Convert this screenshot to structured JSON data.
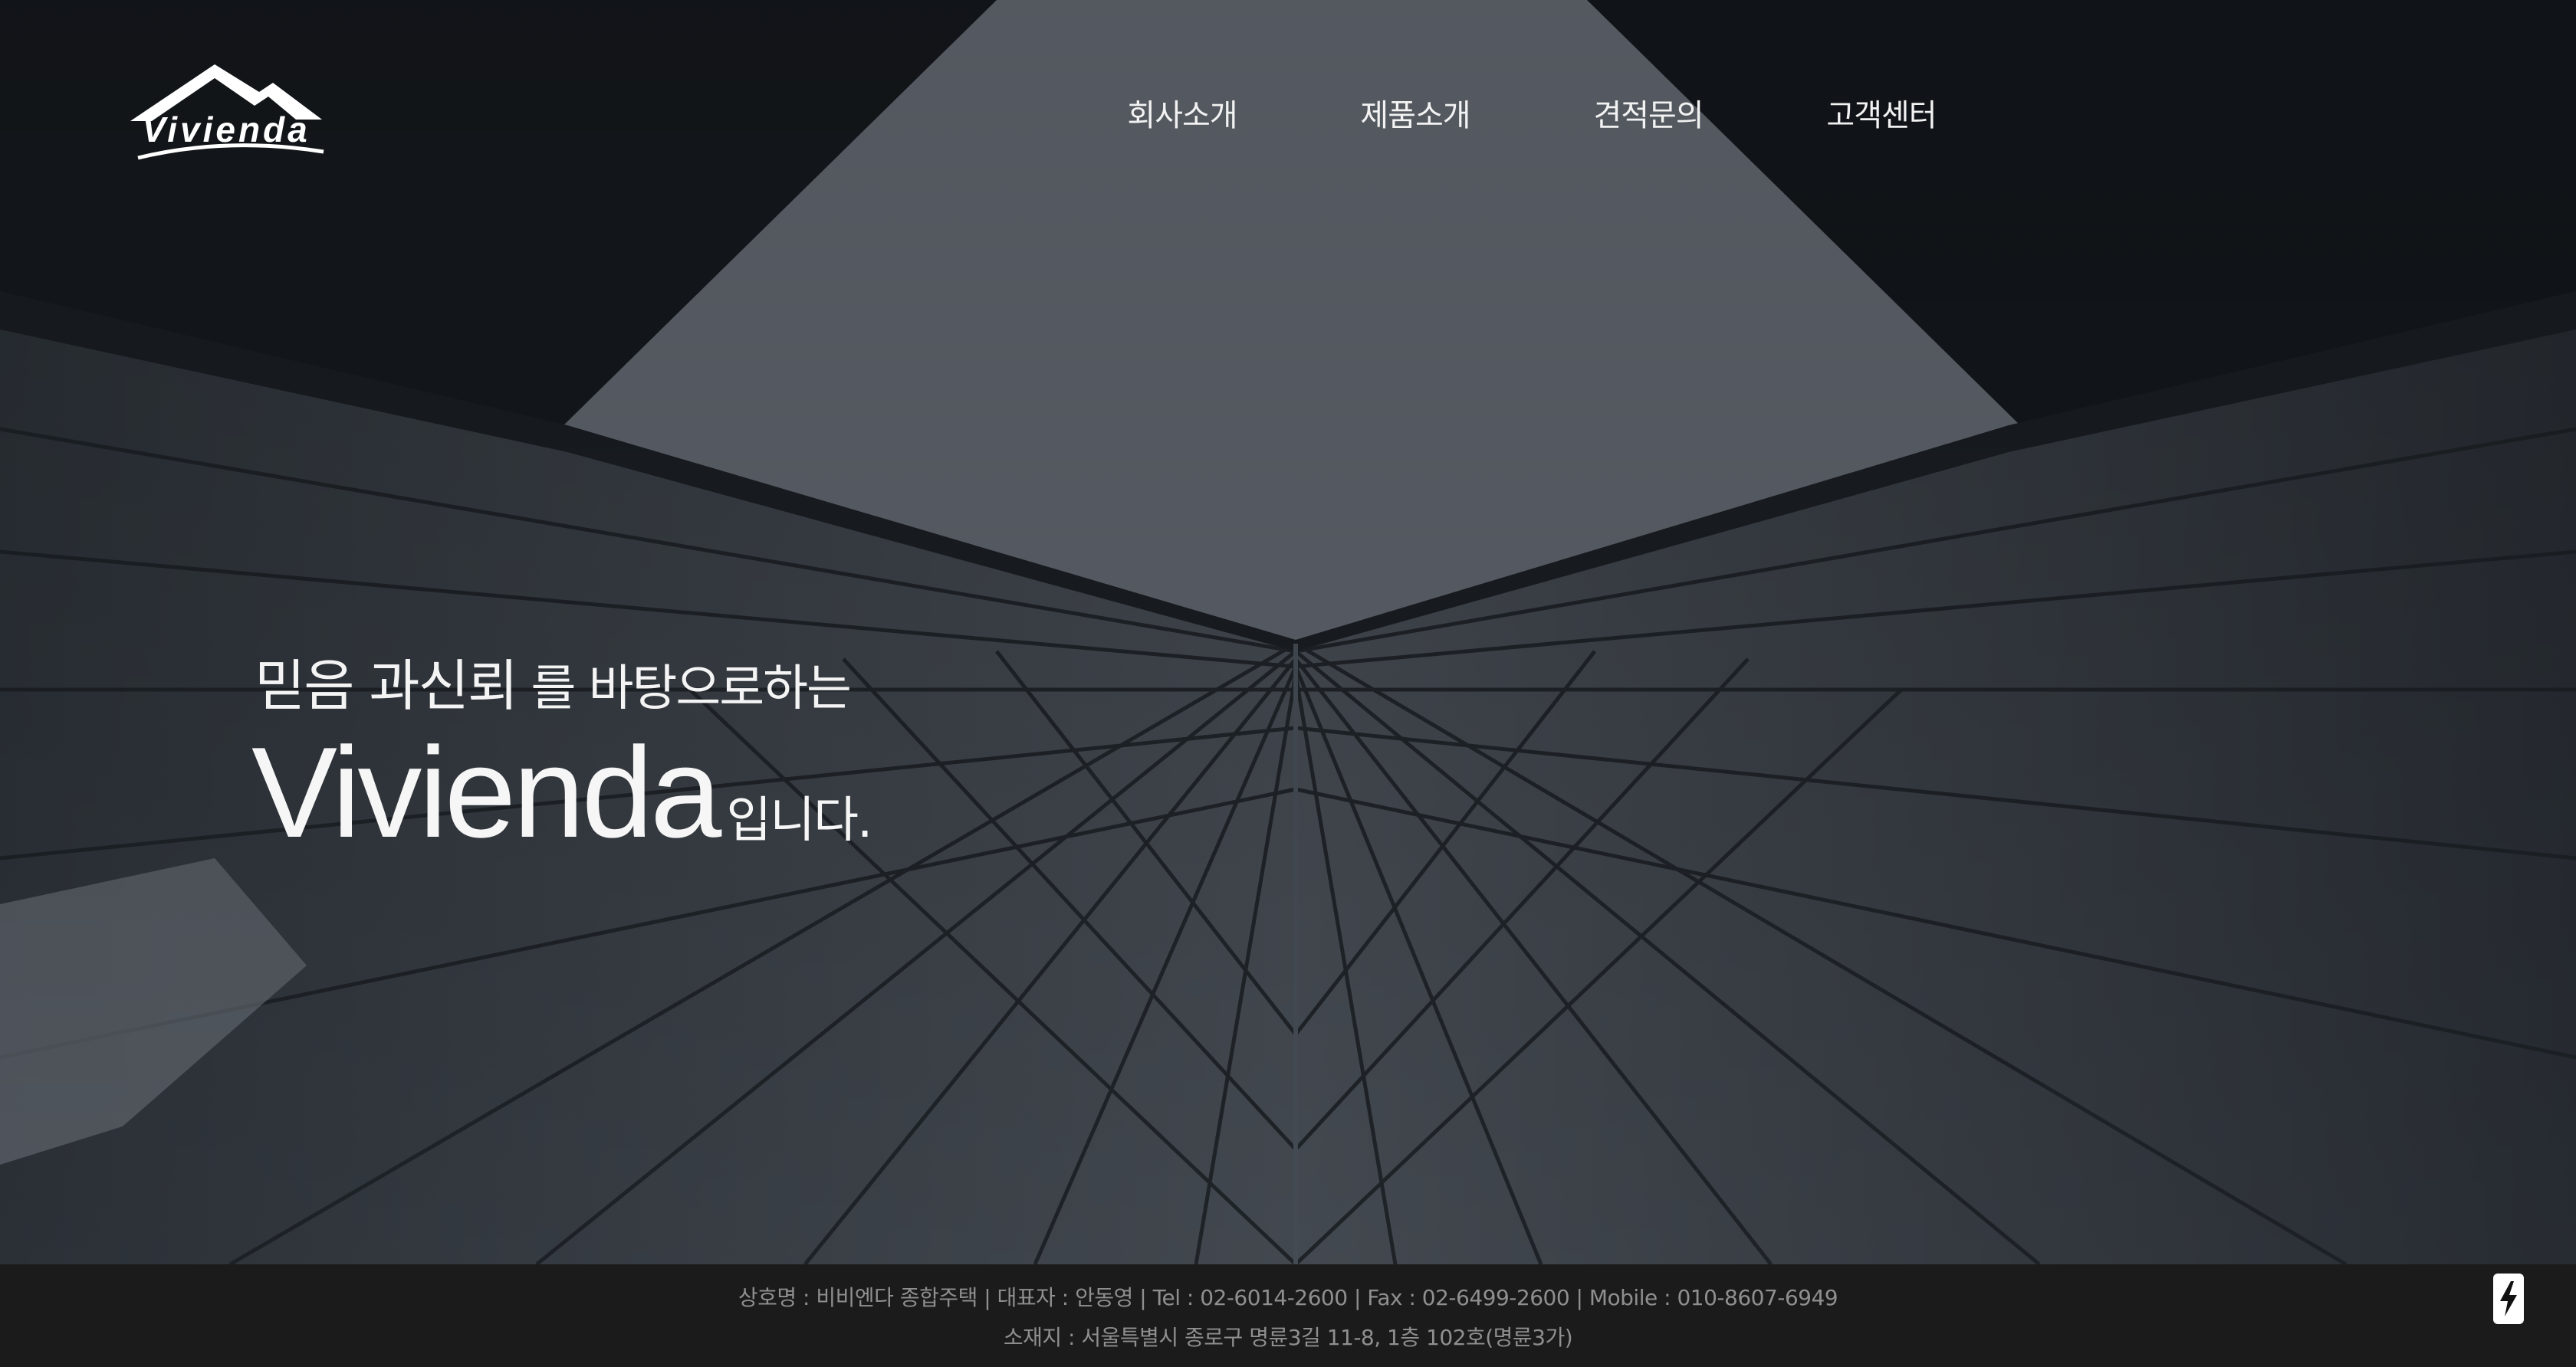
{
  "logo": {
    "text": "Vivienda"
  },
  "nav": {
    "items": [
      {
        "label": "회사소개"
      },
      {
        "label": "제품소개"
      },
      {
        "label": "견적문의"
      },
      {
        "label": "고객센터"
      }
    ]
  },
  "hero": {
    "tagline_part1": "믿음 과신뢰",
    "tagline_part2": " 를 바탕으로하는",
    "brand": "Vivienda",
    "brand_suffix": "입니다."
  },
  "footer": {
    "line1": "상호명 : 비비엔다 종합주택 | 대표자 : 안동영 | Tel : 02-6014-2600 | Fax : 02-6499-2600 | Mobile : 010-8607-6949",
    "line2": "소재지 : 서울특별시 종로구 명륜3길 11-8, 1층 102호(명륜3가)"
  },
  "colors": {
    "footer_bg": "#1b1b1b",
    "footer_text": "#8f8f8f",
    "hero_text": "#f4f4f4"
  },
  "icons": {
    "logo": "roof-logo-icon",
    "badge": "lightning-bolt-icon"
  }
}
